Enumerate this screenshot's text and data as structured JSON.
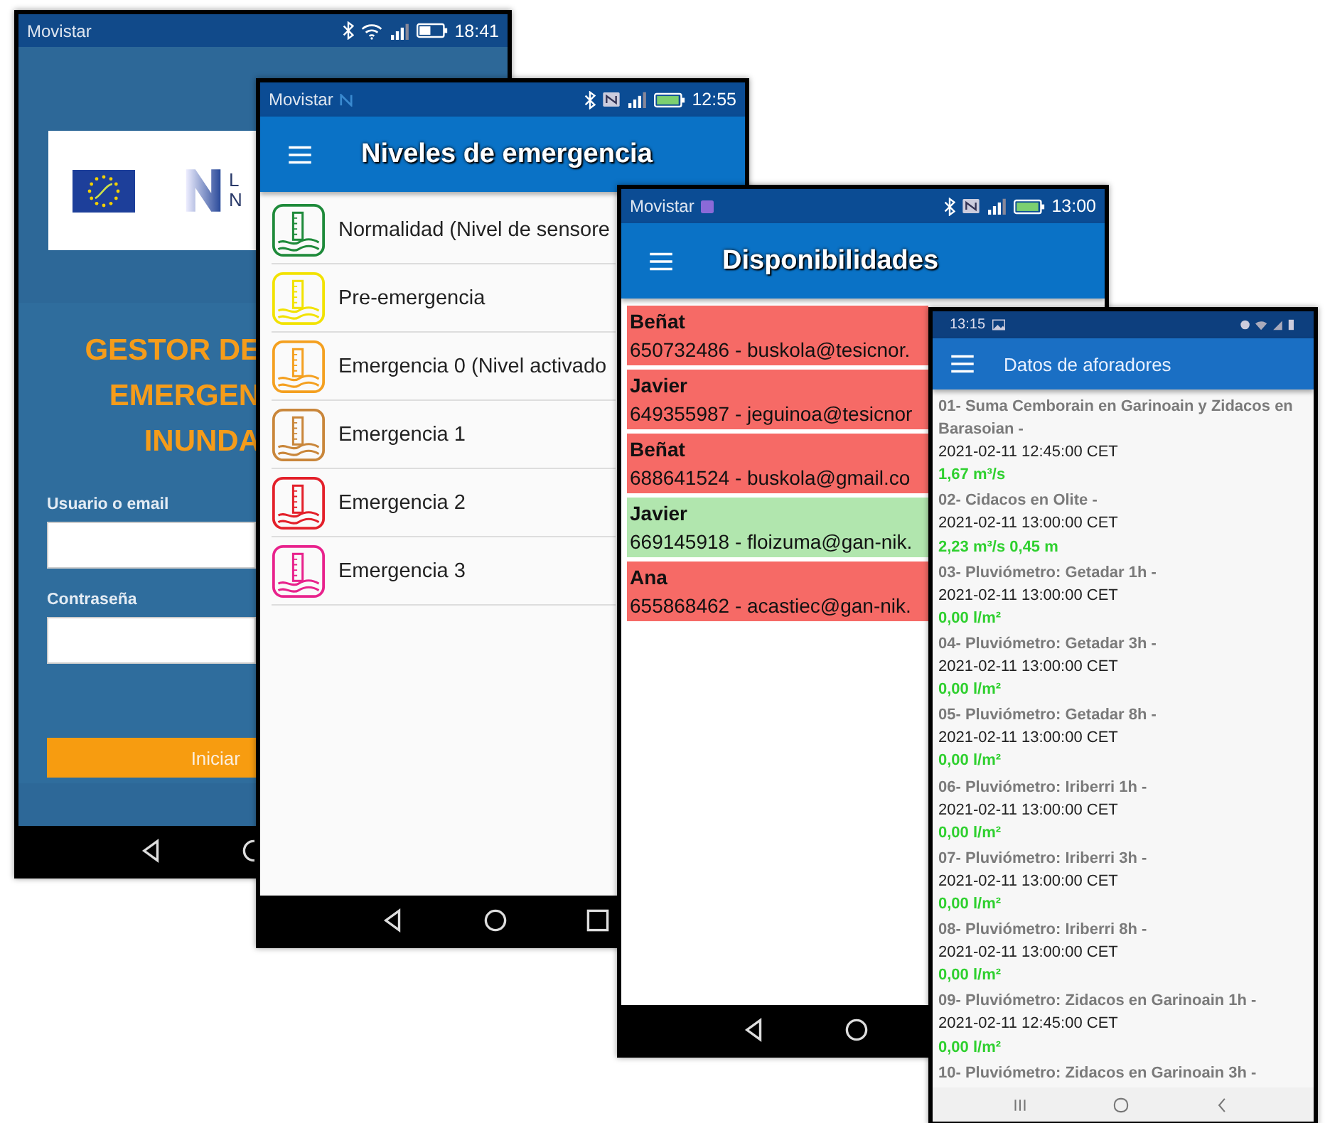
{
  "phones": [
    {
      "kind": "login",
      "status_bar": {
        "carrier": "Movistar",
        "time": "18:41"
      },
      "logo_text": [
        "L",
        "N"
      ],
      "title_lines": [
        "GESTOR DE",
        "EMERGEN",
        "INUNDA"
      ],
      "fields": [
        {
          "label": "Usuario o email"
        },
        {
          "label": "Contraseña"
        }
      ],
      "button": "Iniciar"
    },
    {
      "kind": "levels",
      "status_bar": {
        "carrier": "Movistar",
        "time": "12:55"
      },
      "title": "Niveles de emergencia",
      "levels": [
        {
          "label": "Normalidad (Nivel de sensore",
          "color": "#1e8a3a"
        },
        {
          "label": "Pre-emergencia",
          "color": "#f2e200"
        },
        {
          "label": "Emergencia 0 (Nivel activado",
          "color": "#f4a020"
        },
        {
          "label": "Emergencia 1",
          "color": "#c9863a"
        },
        {
          "label": "Emergencia 2",
          "color": "#e3202a"
        },
        {
          "label": "Emergencia 3",
          "color": "#e8228c"
        }
      ]
    },
    {
      "kind": "availability",
      "status_bar": {
        "carrier": "Movistar",
        "time": "13:00"
      },
      "title": "Disponibilidades",
      "contacts": [
        {
          "name": "Beñat",
          "details": "650732486 - buskola@tesicnor.",
          "available": false
        },
        {
          "name": "Javier",
          "details": "649355987 - jeguinoa@tesicnor",
          "available": false
        },
        {
          "name": "Beñat",
          "details": "688641524 - buskola@gmail.co",
          "available": false
        },
        {
          "name": "Javier",
          "details": "669145918 - floizuma@gan-nik.",
          "available": true
        },
        {
          "name": "Ana",
          "details": "655868462 - acastiec@gan-nik.",
          "available": false
        }
      ]
    },
    {
      "kind": "gauges",
      "status_bar": {
        "time": "13:15"
      },
      "title": "Datos de aforadores",
      "readings": [
        {
          "station": "01- Suma Cemborain en Garinoain y Zidacos en Barasoian -",
          "timestamp": "2021-02-11 12:45:00 CET",
          "value": "1,67 m³/s"
        },
        {
          "station": "02- Cidacos en Olite -",
          "timestamp": "2021-02-11 13:00:00 CET",
          "value": "2,23 m³/s 0,45 m"
        },
        {
          "station": "03- Pluviómetro: Getadar 1h -",
          "timestamp": "2021-02-11 13:00:00 CET",
          "value": "0,00 l/m²"
        },
        {
          "station": "04- Pluviómetro: Getadar 3h -",
          "timestamp": "2021-02-11 13:00:00 CET",
          "value": "0,00 l/m²"
        },
        {
          "station": "05- Pluviómetro: Getadar 8h -",
          "timestamp": "2021-02-11 13:00:00 CET",
          "value": "0,00 l/m²"
        },
        {
          "station": "06- Pluviómetro: Iriberri 1h -",
          "timestamp": "2021-02-11 13:00:00 CET",
          "value": "0,00 l/m²"
        },
        {
          "station": "07- Pluviómetro: Iriberri 3h -",
          "timestamp": "2021-02-11 13:00:00 CET",
          "value": "0,00 l/m²"
        },
        {
          "station": "08- Pluviómetro: Iriberri 8h -",
          "timestamp": "2021-02-11 13:00:00 CET",
          "value": "0,00 l/m²"
        },
        {
          "station": "09- Pluviómetro: Zidacos en Garinoain 1h -",
          "timestamp": "2021-02-11 12:45:00 CET",
          "value": "0,00 l/m²"
        },
        {
          "station": "10- Pluviómetro: Zidacos en Garinoain 3h -"
        }
      ]
    }
  ]
}
